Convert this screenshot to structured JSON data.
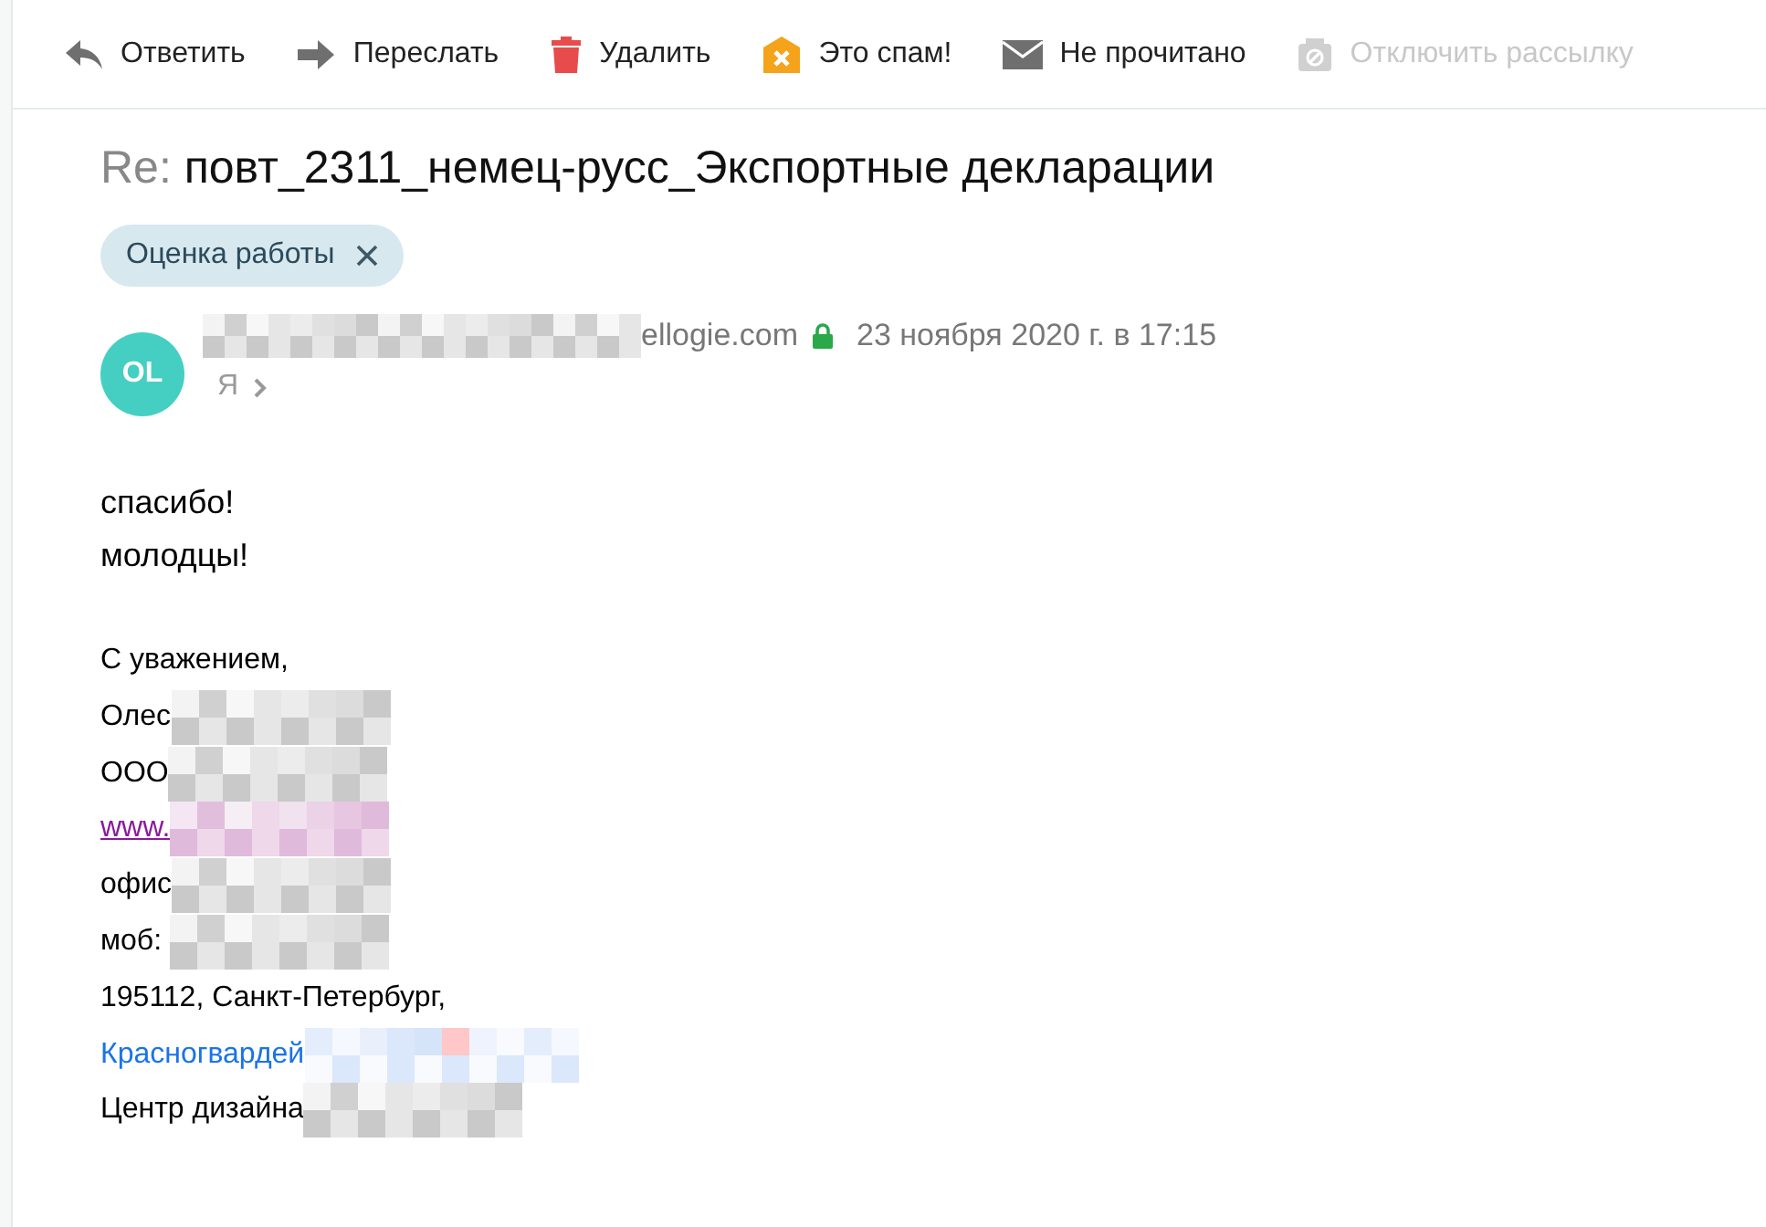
{
  "toolbar": [
    {
      "kind": "reply",
      "label": "Ответить",
      "disabled": false
    },
    {
      "kind": "forward",
      "label": "Переслать",
      "disabled": false
    },
    {
      "kind": "delete",
      "label": "Удалить",
      "disabled": false
    },
    {
      "kind": "spam",
      "label": "Это спам!",
      "disabled": false
    },
    {
      "kind": "unread",
      "label": "Не прочитано",
      "disabled": false
    },
    {
      "kind": "unsubscribe",
      "label": "Отключить рассылку",
      "disabled": true
    }
  ],
  "subject": {
    "prefix": "Re:",
    "text": "повт_2311_немец-русс_Экспортные декларации"
  },
  "labels": [
    {
      "text": "Оценка работы"
    }
  ],
  "sender": {
    "initials": "OL",
    "address_tail": "ellogie.com",
    "redacted": true,
    "secure": true,
    "date": "23 ноября 2020 г. в 17:15",
    "recipient": "Я"
  },
  "body": [
    "спасибо!",
    "молодцы!"
  ],
  "signature": [
    {
      "kind": "text",
      "text": "С уважением,",
      "redacted": false
    },
    {
      "kind": "text",
      "text": "Олес",
      "redacted": true
    },
    {
      "kind": "text",
      "text": "ООО",
      "redacted": true
    },
    {
      "kind": "visited-link",
      "text": "www.",
      "redacted": true
    },
    {
      "kind": "text",
      "text": "офис",
      "redacted": true
    },
    {
      "kind": "text",
      "text": "моб: ",
      "redacted": true
    },
    {
      "kind": "text",
      "text": "195112, Санкт-Петербург,",
      "redacted": false
    },
    {
      "kind": "link",
      "text": "Красногвардей",
      "redacted": true
    },
    {
      "kind": "text",
      "text": "Центр дизайна",
      "redacted": true
    }
  ]
}
